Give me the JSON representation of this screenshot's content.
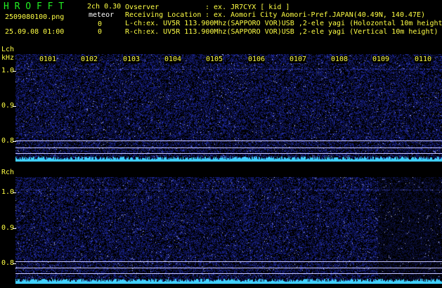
{
  "app": {
    "logo": "H R O F F T",
    "version": "2ch 0.30",
    "mode": "meteor",
    "filename": "2509080100.png",
    "datetime": "25.09.08 01:00",
    "count_l": "0",
    "count_r": "0"
  },
  "info": {
    "observer_label": "Ovserver",
    "observer_value": ": ex. JR7CYX [ kid ]",
    "location_label": "Receiving Location",
    "location_value": ": ex. Aomori City Aomori-Pref.JAPAN(40.49N, 140.47E)",
    "lch_desc": "L-ch:ex. UV5R 113.900Mhz(SAPPORO VOR)USB ,2-ele yagi (Holozontal 10m height)",
    "rch_desc": "R-ch:ex. UV5R 113.900Mhz(SAPPORO VOR)USB ,2-ele yagi (Vertical 10m height)"
  },
  "time_labels": [
    "0101",
    "0102",
    "0103",
    "0104",
    "0105",
    "0106",
    "0107",
    "0108",
    "0109",
    "0110"
  ],
  "lch": {
    "title": "Lch",
    "unit": "kHz",
    "ticks": [
      "1.0",
      "0.9",
      "0.8"
    ]
  },
  "rch": {
    "title": "Rch",
    "ticks": [
      "1.0",
      "0.9",
      "0.8"
    ]
  },
  "colors": {
    "background": "#000000",
    "logo": "#22ee22",
    "text_yellow": "#ffff44",
    "noise_blue": "#1a2a9a",
    "signal_cyan": "#3fd0ff"
  }
}
